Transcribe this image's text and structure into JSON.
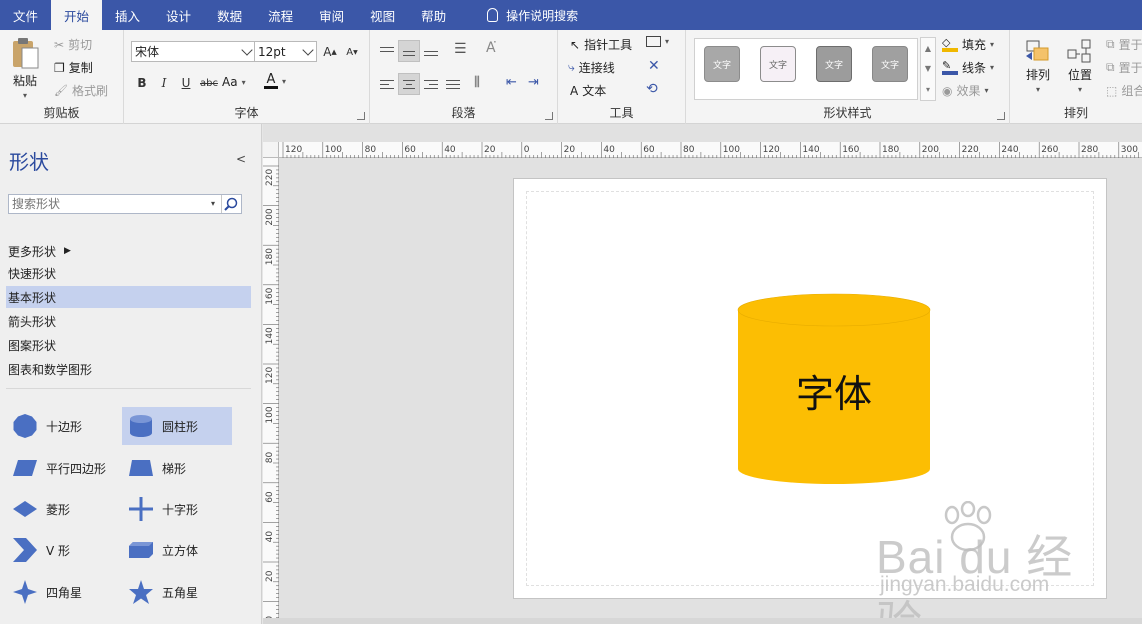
{
  "menu": {
    "tabs": [
      "文件",
      "开始",
      "插入",
      "设计",
      "数据",
      "流程",
      "审阅",
      "视图",
      "帮助"
    ],
    "active_index": 1,
    "tell_me": "操作说明搜索"
  },
  "ribbon": {
    "clipboard": {
      "label": "剪贴板",
      "paste": "粘贴",
      "cut": "剪切",
      "copy": "复制",
      "format_painter": "格式刷"
    },
    "font": {
      "label": "字体",
      "font_name": "宋体",
      "font_size": "12pt",
      "grow": "A",
      "shrink": "A",
      "bold": "B",
      "italic": "I",
      "underline": "U",
      "strike": "abc",
      "case": "Aa",
      "color": "A"
    },
    "paragraph": {
      "label": "段落"
    },
    "tools": {
      "label": "工具",
      "pointer": "指针工具",
      "connector": "连接线",
      "text": "文本",
      "text_icon": "A"
    },
    "shape_styles": {
      "label": "形状样式",
      "samples": [
        "文字",
        "文字",
        "文字",
        "文字"
      ],
      "fill": "填充",
      "line": "线条",
      "effects": "效果"
    },
    "arrange": {
      "label": "排列",
      "arrange": "排列",
      "position": "位置",
      "bring_front": "置于",
      "send_back": "置于",
      "group": "组合"
    }
  },
  "pane": {
    "title": "形状",
    "collapse": "<",
    "search_placeholder": "搜索形状",
    "stencils": [
      "更多形状",
      "快速形状",
      "基本形状",
      "箭头形状",
      "图案形状",
      "图表和数学图形"
    ],
    "selected_stencil": 2,
    "shapes": [
      "十边形",
      "圆柱形",
      "平行四边形",
      "梯形",
      "菱形",
      "十字形",
      "V 形",
      "立方体",
      "四角星",
      "五角星"
    ],
    "selected_shape": 1
  },
  "canvas": {
    "shape_text": "字体",
    "ruler_h": [
      "120",
      "100",
      "80",
      "60",
      "40",
      "20",
      "0",
      "20",
      "40",
      "60",
      "80",
      "100",
      "120",
      "140",
      "160",
      "180",
      "200",
      "220",
      "240",
      "260",
      "280",
      "300"
    ],
    "ruler_v": [
      "220",
      "200",
      "180",
      "160",
      "140",
      "120",
      "100",
      "80",
      "60",
      "40",
      "20",
      "0"
    ],
    "watermark": "Bai du 经验",
    "watermark_sub": "jingyan.baidu.com"
  },
  "colors": {
    "accent": "#3b57a8",
    "cylinder": "#fcbe03",
    "selection": "#c5d1ee"
  }
}
